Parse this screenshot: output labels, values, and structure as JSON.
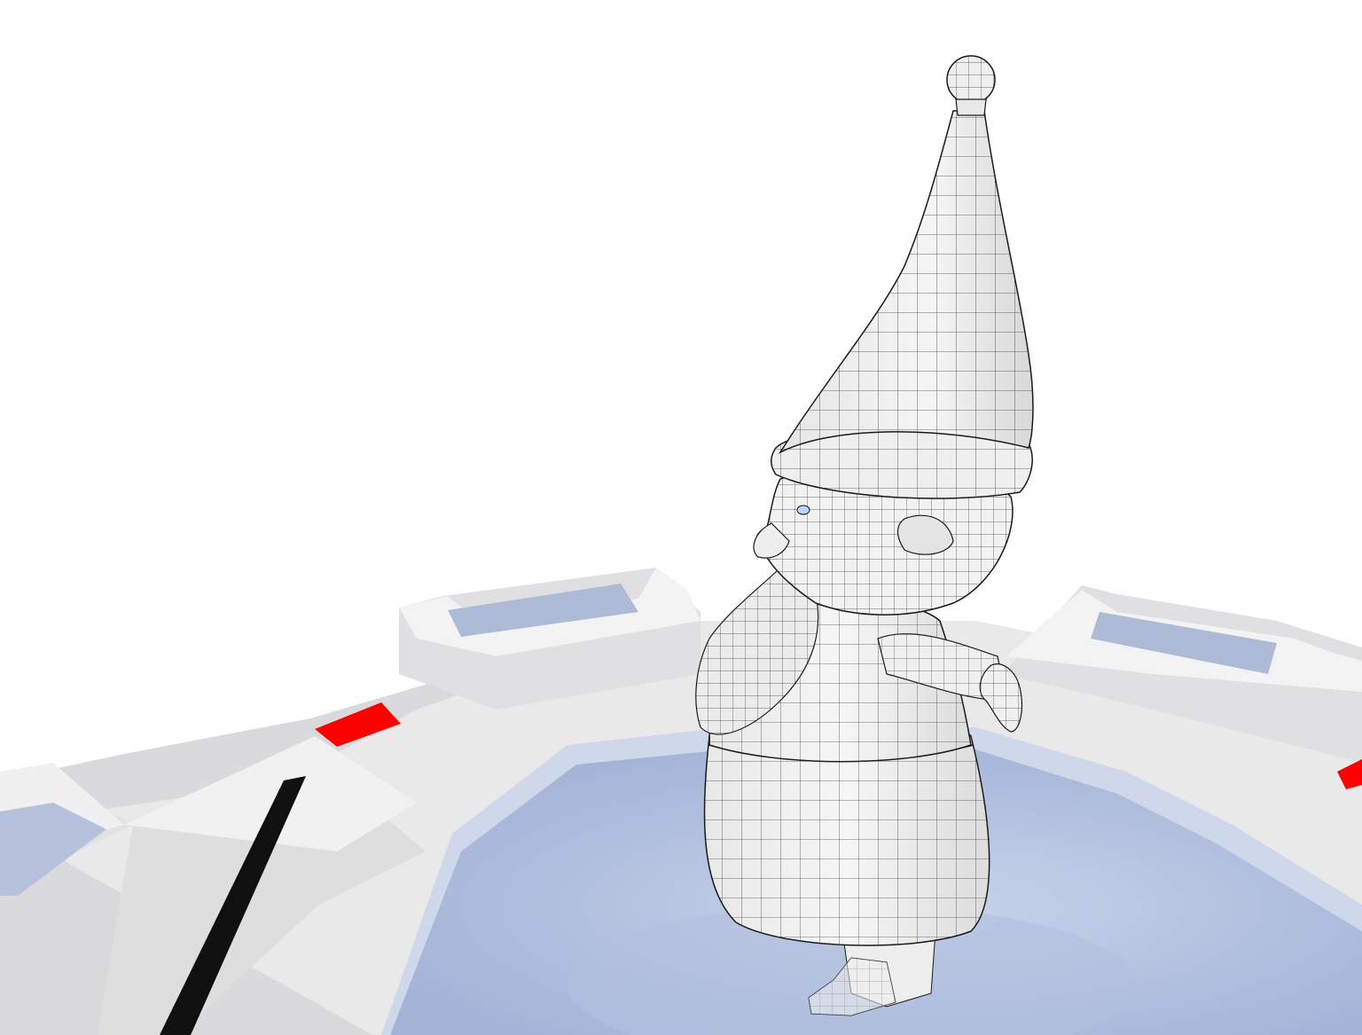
{
  "scene": {
    "subject": "gnome-wireframe-model",
    "background_color": "#ffffff",
    "colors": {
      "mesh_fill": "#f2f2f2",
      "mesh_shade": "#dcdcdc",
      "wire": "#1a1a1a",
      "platform_top": "#efefef",
      "platform_side": "#d4d4d6",
      "platform_dark": "#bfc0c4",
      "glass": "#b8c4de",
      "glass_deep": "#9fb0d6",
      "glass_rim": "#cfd8ea",
      "indicator": "#ff0000",
      "slot": "#101010",
      "eye": "#bcd6ff"
    },
    "icons": [
      "red-indicator-light",
      "red-indicator-light",
      "red-indicator-light"
    ]
  }
}
